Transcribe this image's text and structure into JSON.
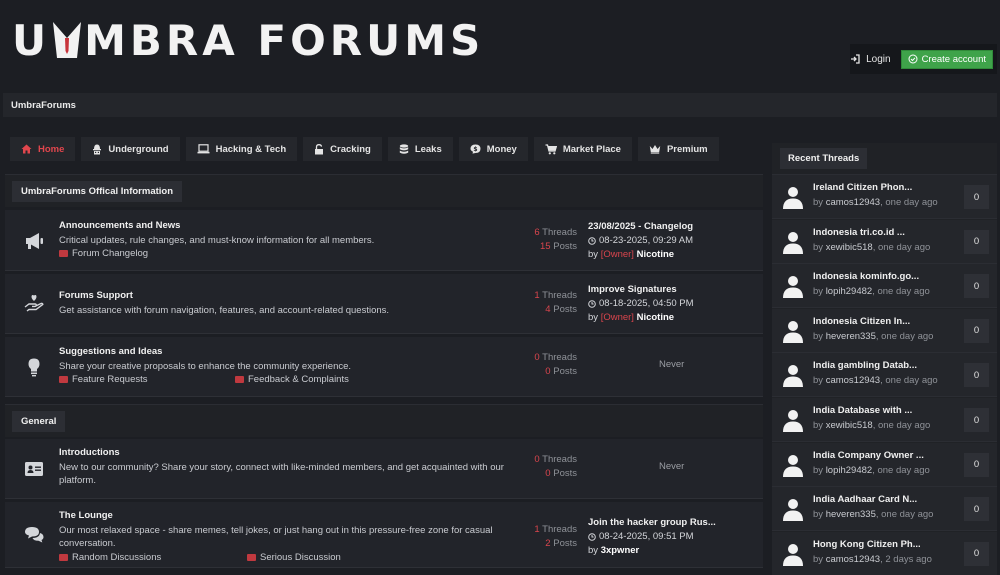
{
  "header": {
    "logo_text_a": "U",
    "logo_text_b": "MBRA FORUMS",
    "login_label": "Login",
    "create_label": "Create account"
  },
  "breadcrumb": {
    "label": "UmbraForums"
  },
  "nav": {
    "items": [
      {
        "label": "Home",
        "icon": "home-icon"
      },
      {
        "label": "Underground",
        "icon": "hat-icon"
      },
      {
        "label": "Hacking & Tech",
        "icon": "laptop-icon"
      },
      {
        "label": "Cracking",
        "icon": "unlock-icon"
      },
      {
        "label": "Leaks",
        "icon": "database-icon"
      },
      {
        "label": "Money",
        "icon": "money-icon"
      },
      {
        "label": "Market Place",
        "icon": "cart-icon"
      },
      {
        "label": "Premium",
        "icon": "crown-icon"
      }
    ]
  },
  "categories": [
    {
      "title": "UmbraForums Offical Information",
      "forums": [
        {
          "name": "Announcements and News",
          "desc": "Critical updates, rule changes, and must-know information for all members.",
          "subs": [
            "Forum Changelog"
          ],
          "threads": "6",
          "posts": "15",
          "threads_label": "Threads",
          "posts_label": "Posts",
          "last_title": "23/08/2025 - Changelog",
          "last_date": "08-23-2025, 09:29 AM",
          "last_by": "by",
          "last_tag": "[Owner]",
          "last_user": "Nicotine"
        },
        {
          "name": "Forums Support",
          "desc": "Get assistance with forum navigation, features, and account-related questions.",
          "threads": "1",
          "posts": "4",
          "threads_label": "Threads",
          "posts_label": "Posts",
          "last_title": "Improve Signatures",
          "last_date": "08-18-2025, 04:50 PM",
          "last_by": "by",
          "last_tag": "[Owner]",
          "last_user": "Nicotine"
        },
        {
          "name": "Suggestions and Ideas",
          "desc": "Share your creative proposals to enhance the community experience.",
          "subs": [
            "Feature Requests",
            "Feedback & Complaints"
          ],
          "threads": "0",
          "posts": "0",
          "threads_label": "Threads",
          "posts_label": "Posts",
          "never": "Never"
        }
      ]
    },
    {
      "title": "General",
      "forums": [
        {
          "name": "Introductions",
          "desc_line1": "New to our community? Share your story, connect with like-minded members, and get acquainted with our",
          "desc_line2": "platform.",
          "threads": "0",
          "posts": "0",
          "threads_label": "Threads",
          "posts_label": "Posts",
          "never": "Never"
        },
        {
          "name": "The Lounge",
          "desc_line1": "Our most relaxed space - share memes, tell jokes, or just hang out in this pressure-free zone for casual",
          "desc_line2": "conversation.",
          "subs": [
            "Random Discussions",
            "Serious Discussion"
          ],
          "threads": "1",
          "posts": "2",
          "threads_label": "Threads",
          "posts_label": "Posts",
          "last_title": "Join the hacker group Rus...",
          "last_date": "08-24-2025, 09:51 PM",
          "last_by": "by",
          "last_user": "3xpwner"
        }
      ]
    }
  ],
  "sidebar": {
    "title": "Recent Threads",
    "threads": [
      {
        "title": "Ireland Citizen Phon...",
        "by": "by",
        "author": "camos12943",
        "when": ", one day ago",
        "replies": "0"
      },
      {
        "title": "Indonesia tri.co.id ...",
        "by": "by",
        "author": "xewibic518",
        "when": ", one day ago",
        "replies": "0"
      },
      {
        "title": "Indonesia kominfo.go...",
        "by": "by",
        "author": "lopih29482",
        "when": ", one day ago",
        "replies": "0"
      },
      {
        "title": "Indonesia Citizen In...",
        "by": "by",
        "author": "heveren335",
        "when": ", one day ago",
        "replies": "0"
      },
      {
        "title": "India gambling Datab...",
        "by": "by",
        "author": "camos12943",
        "when": ", one day ago",
        "replies": "0"
      },
      {
        "title": "India Database with ...",
        "by": "by",
        "author": "xewibic518",
        "when": ", one day ago",
        "replies": "0"
      },
      {
        "title": "India Company Owner ...",
        "by": "by",
        "author": "lopih29482",
        "when": ", one day ago",
        "replies": "0"
      },
      {
        "title": "India Aadhaar Card N...",
        "by": "by",
        "author": "heveren335",
        "when": ", one day ago",
        "replies": "0"
      },
      {
        "title": "Hong Kong Citizen Ph...",
        "by": "by",
        "author": "camos12943",
        "when": ", 2 days ago",
        "replies": "0"
      }
    ]
  },
  "colors": {
    "accent": "#d9454d",
    "create_button": "#3fa34a",
    "background": "#1c1e23"
  }
}
